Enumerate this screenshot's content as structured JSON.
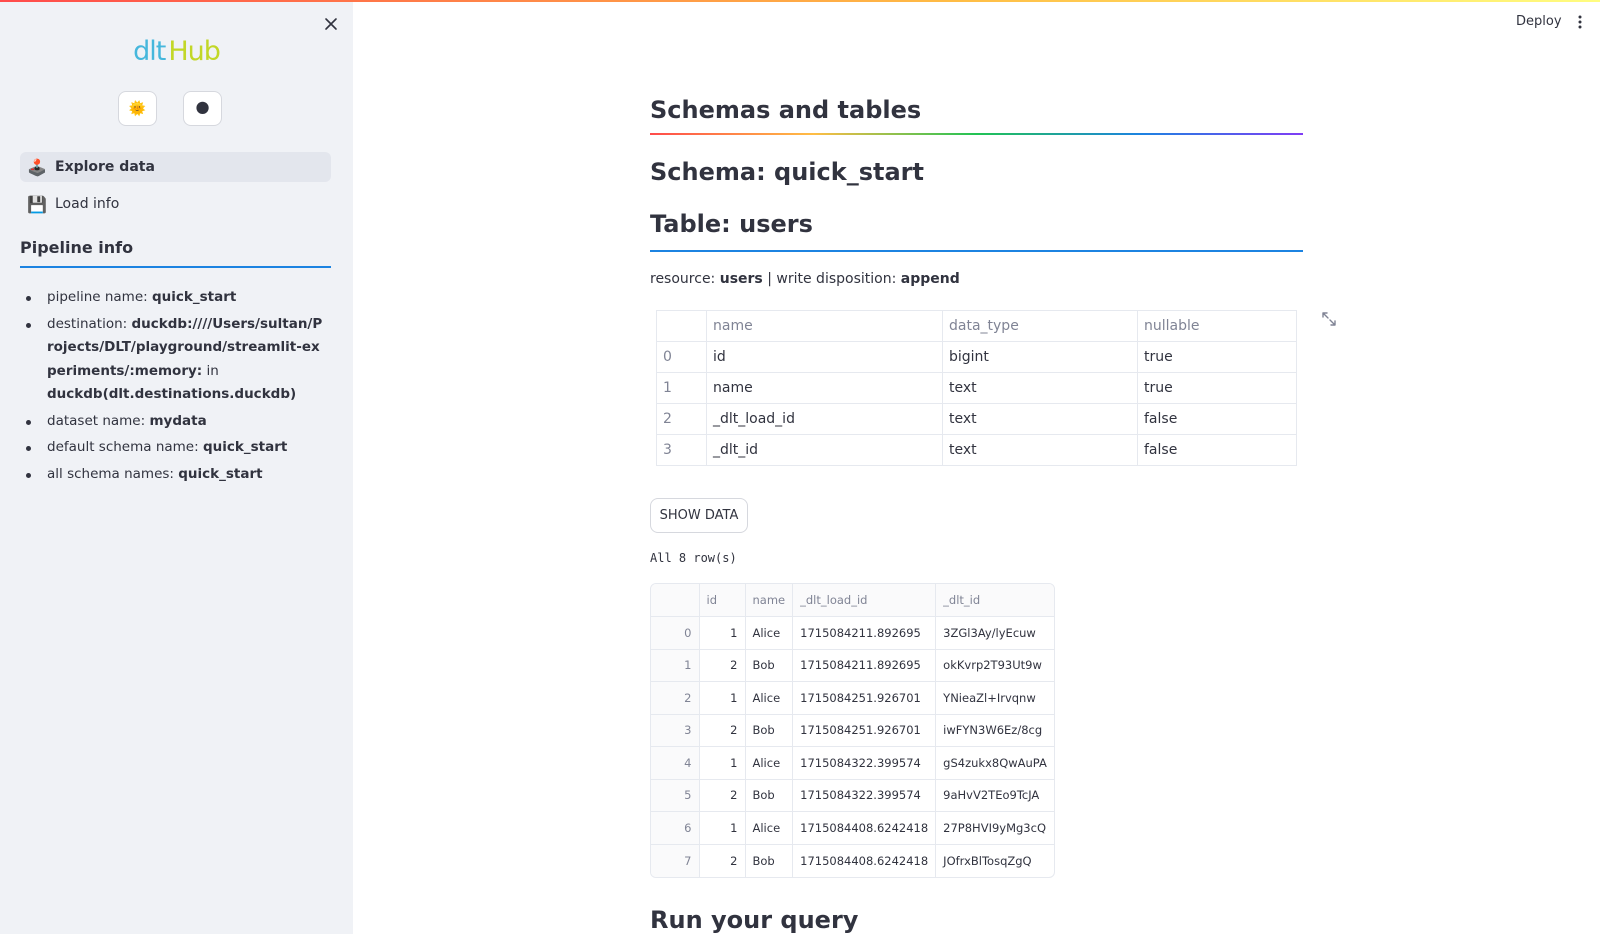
{
  "sidebar": {
    "logo": {
      "part1": "dlt",
      "part2": "Hub"
    },
    "theme_buttons": {
      "light": "🌞",
      "dark": "🌑"
    },
    "nav": [
      {
        "label": "Explore data",
        "icon": "🕹️",
        "active": true
      },
      {
        "label": "Load info",
        "icon": "💾",
        "active": false
      }
    ],
    "pipeline_info_heading": "Pipeline info",
    "pipeline_info": {
      "pipeline_name_label": "pipeline name:",
      "pipeline_name": "quick_start",
      "destination_label": "destination:",
      "destination_value": "duckdb:////Users/sultan/Projects/DLT/playground/streamlit-experiments/:memory:",
      "destination_in": "in",
      "destination_class": "duckdb(dlt.destinations.duckdb)",
      "dataset_name_label": "dataset name:",
      "dataset_name": "mydata",
      "default_schema_label": "default schema name:",
      "default_schema": "quick_start",
      "all_schema_label": "all schema names:",
      "all_schema": "quick_start"
    }
  },
  "header": {
    "deploy_label": "Deploy"
  },
  "main": {
    "section_title": "Schemas and tables",
    "schema_title": "Schema: quick_start",
    "table_title": "Table: users",
    "resource_label": "resource:",
    "resource_value": "users",
    "separator": "|",
    "write_label": "write disposition:",
    "write_value": "append",
    "schema_table": {
      "headers": [
        "",
        "name",
        "data_type",
        "nullable"
      ],
      "rows": [
        [
          "0",
          "id",
          "bigint",
          "true"
        ],
        [
          "1",
          "name",
          "text",
          "true"
        ],
        [
          "2",
          "_dlt_load_id",
          "text",
          "false"
        ],
        [
          "3",
          "_dlt_id",
          "text",
          "false"
        ]
      ]
    },
    "show_data_label": "SHOW DATA",
    "rows_caption": "All 8 row(s)",
    "data_table": {
      "headers": [
        "",
        "id",
        "name",
        "_dlt_load_id",
        "_dlt_id"
      ],
      "rows": [
        [
          "0",
          "1",
          "Alice",
          "1715084211.892695",
          "3ZGl3Ay/lyEcuw"
        ],
        [
          "1",
          "2",
          "Bob",
          "1715084211.892695",
          "okKvrp2T93Ut9w"
        ],
        [
          "2",
          "1",
          "Alice",
          "1715084251.926701",
          "YNieaZl+Irvqnw"
        ],
        [
          "3",
          "2",
          "Bob",
          "1715084251.926701",
          "iwFYN3W6Ez/8cg"
        ],
        [
          "4",
          "1",
          "Alice",
          "1715084322.399574",
          "gS4zukx8QwAuPA"
        ],
        [
          "5",
          "2",
          "Bob",
          "1715084322.399574",
          "9aHvV2TEo9TcJA"
        ],
        [
          "6",
          "1",
          "Alice",
          "1715084408.6242418",
          "27P8HVI9yMg3cQ"
        ],
        [
          "7",
          "2",
          "Bob",
          "1715084408.6242418",
          "JOfrxBlTosqZgQ"
        ]
      ]
    },
    "query_title": "Run your query"
  },
  "colors": {
    "sidebar_bg": "#f0f2f6",
    "accent_blue": "#1c83e1",
    "logo_dlt": "#46b7dc",
    "logo_hub": "#c2d727",
    "text": "#31333f"
  }
}
